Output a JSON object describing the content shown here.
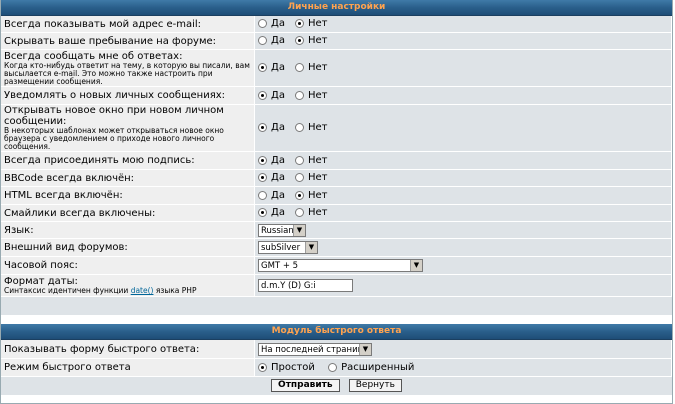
{
  "section1": {
    "title": "Личные настройки",
    "rows": [
      {
        "label": "Всегда показывать мой адрес e-mail:",
        "sub": "",
        "yes": "Да",
        "no": "Нет",
        "selected": "no"
      },
      {
        "label": "Скрывать ваше пребывание на форуме:",
        "sub": "",
        "yes": "Да",
        "no": "Нет",
        "selected": "no"
      },
      {
        "label": "Всегда сообщать мне об ответах:",
        "sub": "Когда кто-нибудь ответит на тему, в которую вы писали, вам высылается e-mail. Это можно также настроить при размещении сообщения.",
        "yes": "Да",
        "no": "Нет",
        "selected": "yes"
      },
      {
        "label": "Уведомлять о новых личных сообщениях:",
        "sub": "",
        "yes": "Да",
        "no": "Нет",
        "selected": "yes"
      },
      {
        "label": "Открывать новое окно при новом личном сообщении:",
        "sub": "В некоторых шаблонах может открываться новое окно браузера с уведомлением о приходе нового личного сообщения.",
        "yes": "Да",
        "no": "Нет",
        "selected": "yes"
      },
      {
        "label": "Всегда присоединять мою подпись:",
        "sub": "",
        "yes": "Да",
        "no": "Нет",
        "selected": "yes"
      },
      {
        "label": "BBCode всегда включён:",
        "sub": "",
        "yes": "Да",
        "no": "Нет",
        "selected": "yes"
      },
      {
        "label": "HTML всегда включён:",
        "sub": "",
        "yes": "Да",
        "no": "Нет",
        "selected": "no"
      },
      {
        "label": "Смайлики всегда включены:",
        "sub": "",
        "yes": "Да",
        "no": "Нет",
        "selected": "yes"
      }
    ],
    "language": {
      "label": "Язык:",
      "value": "Russian"
    },
    "style": {
      "label": "Внешний вид форумов:",
      "value": "subSilver"
    },
    "timezone": {
      "label": "Часовой пояс:",
      "value": "GMT + 5"
    },
    "dateformat": {
      "label": "Формат даты:",
      "sub_before": "Синтаксис идентичен функции ",
      "sub_link": "date()",
      "sub_after": " языка PHP",
      "value": "d.m.Y (D) G:i"
    }
  },
  "section2": {
    "title": "Модуль быстрого ответа",
    "show_form": {
      "label": "Показывать форму быстрого ответа:",
      "value": "На последней странице"
    },
    "mode": {
      "label": "Режим быстрого ответа",
      "simple": "Простой",
      "advanced": "Расширенный",
      "selected": "simple"
    }
  },
  "buttons": {
    "submit": "Отправить",
    "reset": "Вернуть"
  }
}
